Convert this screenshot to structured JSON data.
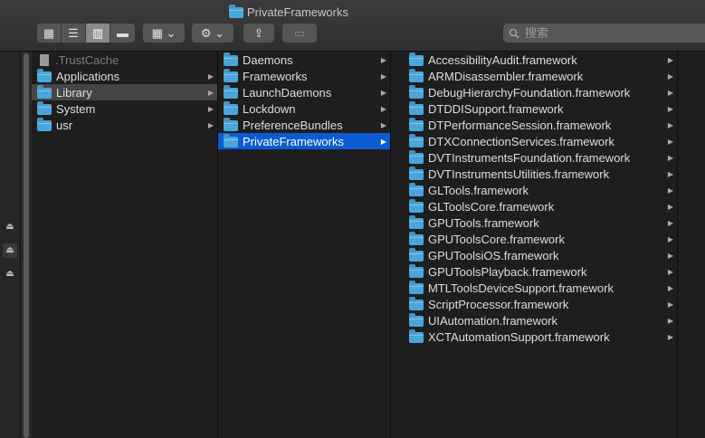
{
  "window": {
    "title": "PrivateFrameworks"
  },
  "toolbar": {
    "view_buttons": [
      {
        "name": "icon-view-button",
        "glyph": "▦",
        "active": false
      },
      {
        "name": "list-view-button",
        "glyph": "☰",
        "active": false
      },
      {
        "name": "column-view-button",
        "glyph": "▥",
        "active": true
      },
      {
        "name": "gallery-view-button",
        "glyph": "▬",
        "active": false
      }
    ],
    "group_glyph": "▦ ⌄",
    "action_glyph": "⚙ ⌄",
    "share_glyph": "⇪",
    "tags_glyph": "▭"
  },
  "search": {
    "placeholder": "搜索",
    "icon": "search-icon"
  },
  "columns": [
    {
      "items": [
        {
          "label": ".TrustCache",
          "type": "file",
          "has_children": false,
          "state": "dim"
        },
        {
          "label": "Applications",
          "type": "folder",
          "has_children": true
        },
        {
          "label": "Library",
          "type": "folder",
          "has_children": true,
          "state": "selected-gray"
        },
        {
          "label": "System",
          "type": "folder",
          "has_children": true
        },
        {
          "label": "usr",
          "type": "folder",
          "has_children": true
        }
      ]
    },
    {
      "items": [
        {
          "label": "Daemons",
          "type": "folder",
          "has_children": true
        },
        {
          "label": "Frameworks",
          "type": "folder",
          "has_children": true
        },
        {
          "label": "LaunchDaemons",
          "type": "folder",
          "has_children": true
        },
        {
          "label": "Lockdown",
          "type": "folder",
          "has_children": true
        },
        {
          "label": "PreferenceBundles",
          "type": "folder",
          "has_children": true
        },
        {
          "label": "PrivateFrameworks",
          "type": "folder",
          "has_children": true,
          "state": "selected-blue"
        }
      ]
    },
    {
      "items": [
        {
          "label": "AccessibilityAudit.framework",
          "type": "folder",
          "has_children": true
        },
        {
          "label": "ARMDisassembler.framework",
          "type": "folder",
          "has_children": true
        },
        {
          "label": "DebugHierarchyFoundation.framework",
          "type": "folder",
          "has_children": true
        },
        {
          "label": "DTDDISupport.framework",
          "type": "folder",
          "has_children": true
        },
        {
          "label": "DTPerformanceSession.framework",
          "type": "folder",
          "has_children": true
        },
        {
          "label": "DTXConnectionServices.framework",
          "type": "folder",
          "has_children": true
        },
        {
          "label": "DVTInstrumentsFoundation.framework",
          "type": "folder",
          "has_children": true
        },
        {
          "label": "DVTInstrumentsUtilities.framework",
          "type": "folder",
          "has_children": true
        },
        {
          "label": "GLTools.framework",
          "type": "folder",
          "has_children": true
        },
        {
          "label": "GLToolsCore.framework",
          "type": "folder",
          "has_children": true
        },
        {
          "label": "GPUTools.framework",
          "type": "folder",
          "has_children": true
        },
        {
          "label": "GPUToolsCore.framework",
          "type": "folder",
          "has_children": true
        },
        {
          "label": "GPUToolsiOS.framework",
          "type": "folder",
          "has_children": true
        },
        {
          "label": "GPUToolsPlayback.framework",
          "type": "folder",
          "has_children": true
        },
        {
          "label": "MTLToolsDeviceSupport.framework",
          "type": "folder",
          "has_children": true
        },
        {
          "label": "ScriptProcessor.framework",
          "type": "folder",
          "has_children": true
        },
        {
          "label": "UIAutomation.framework",
          "type": "folder",
          "has_children": true
        },
        {
          "label": "XCTAutomationSupport.framework",
          "type": "folder",
          "has_children": true
        }
      ]
    }
  ],
  "colors": {
    "selection": "#0a5bd4",
    "folder": "#4aa6d8",
    "background": "#1e1e1e"
  }
}
